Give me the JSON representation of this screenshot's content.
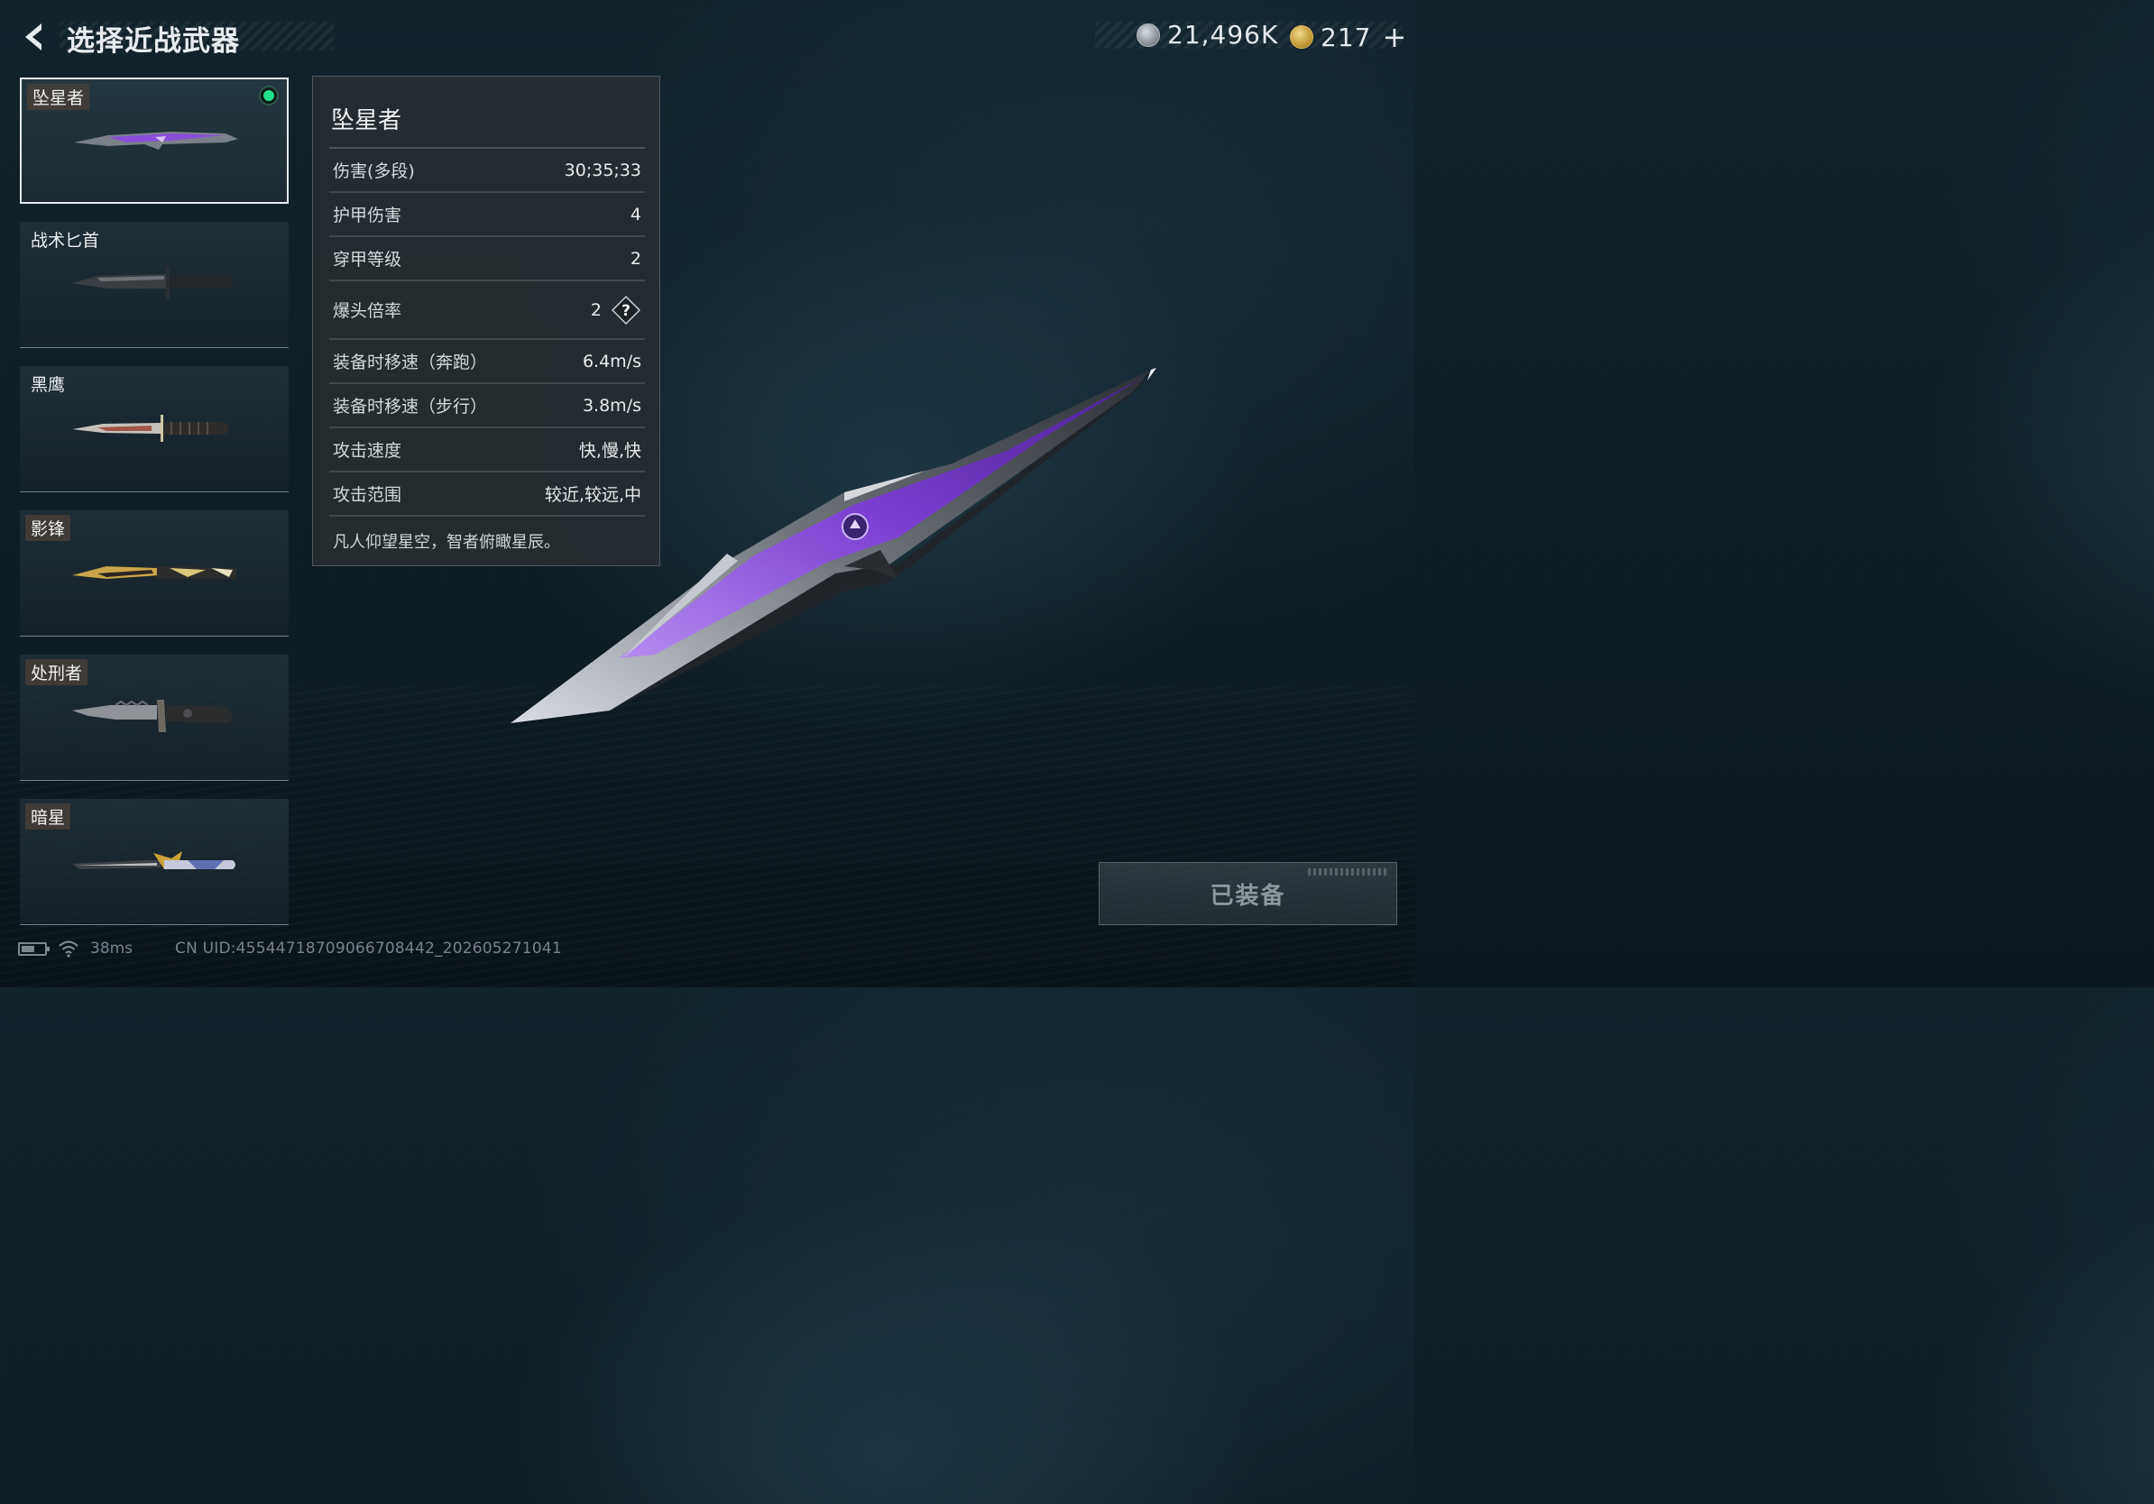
{
  "header": {
    "back_icon": "back-arrow-icon",
    "title": "选择近战武器",
    "currency_silver": "21,496K",
    "currency_gold": "217",
    "plus_label": "+"
  },
  "weapons": [
    {
      "name": "坠星者",
      "selected": true,
      "equipped": true
    },
    {
      "name": "战术匕首",
      "selected": false,
      "equipped": false
    },
    {
      "name": "黑鹰",
      "selected": false,
      "equipped": false
    },
    {
      "name": "影锋",
      "selected": false,
      "equipped": false
    },
    {
      "name": "处刑者",
      "selected": false,
      "equipped": false
    },
    {
      "name": "暗星",
      "selected": false,
      "equipped": false
    }
  ],
  "stats": {
    "title": "坠星者",
    "rows": [
      {
        "label": "伤害(多段)",
        "value": "30;35;33"
      },
      {
        "label": "护甲伤害",
        "value": "4"
      },
      {
        "label": "穿甲等级",
        "value": "2"
      },
      {
        "label": "爆头倍率",
        "value": "2"
      },
      {
        "label": "装备时移速（奔跑）",
        "value": "6.4m/s"
      },
      {
        "label": "装备时移速（步行）",
        "value": "3.8m/s"
      },
      {
        "label": "攻击速度",
        "value": "快,慢,快"
      },
      {
        "label": "攻击范围",
        "value": "较近,较远,中"
      }
    ],
    "help_label": "?",
    "description": "凡人仰望星空，智者俯瞰星辰。"
  },
  "equip_button": {
    "label": "已装备"
  },
  "status": {
    "ping": "38ms",
    "uid": "CN UID:45544718709066708442_202605271041"
  },
  "colors": {
    "accent_green": "#22e08a",
    "knife_purple": "#8a4fd8",
    "panel_bg": "#262d32"
  }
}
